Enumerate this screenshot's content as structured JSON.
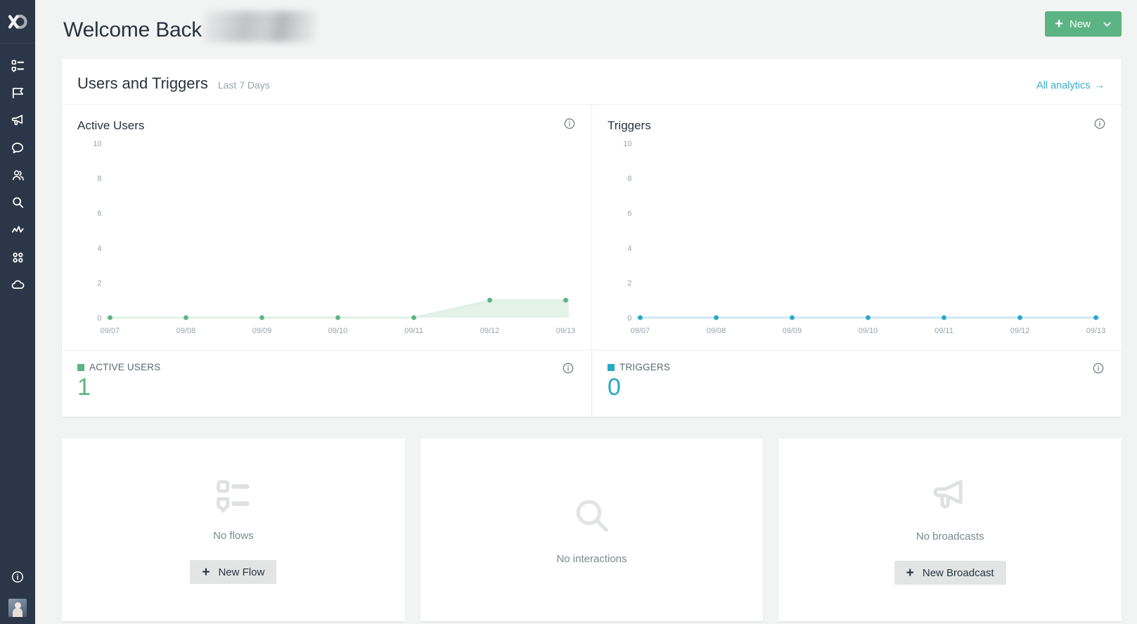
{
  "sidebar": {
    "logo_name": "textit-logo",
    "items": [
      {
        "name": "flows-icon",
        "label": "Flows"
      },
      {
        "name": "campaigns-icon",
        "label": "Campaigns"
      },
      {
        "name": "broadcasts-icon",
        "label": "Broadcasts"
      },
      {
        "name": "messages-icon",
        "label": "Messages"
      },
      {
        "name": "contacts-icon",
        "label": "Contacts"
      },
      {
        "name": "search-icon",
        "label": "Search"
      },
      {
        "name": "analytics-icon",
        "label": "Analytics"
      },
      {
        "name": "apps-icon",
        "label": "Apps"
      },
      {
        "name": "channels-icon",
        "label": "Channels"
      }
    ],
    "bottom": [
      {
        "name": "info-icon",
        "label": "Help"
      },
      {
        "name": "avatar",
        "label": "Account"
      }
    ]
  },
  "header": {
    "greeting": "Welcome Back",
    "user_name_redacted": "",
    "new_button": {
      "label": "New",
      "plus_glyph": "+",
      "chevron": "chevron-down-icon",
      "color": "#5cb383"
    }
  },
  "analytics": {
    "title": "Users and Triggers",
    "subtitle": "Last 7 Days",
    "all_analytics_label": "All analytics",
    "all_analytics_arrow": "→",
    "link_color": "#3aaecb",
    "charts": [
      {
        "title": "Active Users",
        "info": "info-icon"
      },
      {
        "title": "Triggers",
        "info": "info-icon"
      }
    ],
    "stats": [
      {
        "label": "ACTIVE USERS",
        "value": "1",
        "color": "#5cb383",
        "info": "info-icon"
      },
      {
        "label": "TRIGGERS",
        "value": "0",
        "color": "#26a9c7",
        "info": "info-icon"
      }
    ]
  },
  "chart_data": [
    {
      "type": "area",
      "title": "Active Users",
      "x": [
        "09/07",
        "09/08",
        "09/09",
        "09/10",
        "09/11",
        "09/12",
        "09/13"
      ],
      "values": [
        0,
        0,
        0,
        0,
        0,
        1,
        1
      ],
      "yticks": [
        0,
        2,
        4,
        6,
        8,
        10
      ],
      "ylim": [
        0,
        10
      ],
      "xlabel": "",
      "ylabel": "",
      "grid": false,
      "legend": "ACTIVE USERS",
      "color": "#5cb383",
      "fill": "#dff0e4"
    },
    {
      "type": "area",
      "title": "Triggers",
      "x": [
        "09/07",
        "09/08",
        "09/09",
        "09/10",
        "09/11",
        "09/12",
        "09/13"
      ],
      "values": [
        0,
        0,
        0,
        0,
        0,
        0,
        0
      ],
      "yticks": [
        0,
        2,
        4,
        6,
        8,
        10
      ],
      "ylim": [
        0,
        10
      ],
      "xlabel": "",
      "ylabel": "",
      "grid": false,
      "legend": "TRIGGERS",
      "color": "#26a9c7",
      "fill": "#cfe9f2"
    }
  ],
  "bottom_cards": [
    {
      "icon": "flows-icon",
      "text": "No flows",
      "button": "New Flow",
      "plus": "+"
    },
    {
      "icon": "search-icon",
      "text": "No interactions",
      "button": null,
      "plus": "+"
    },
    {
      "icon": "megaphone-icon",
      "text": "No broadcasts",
      "button": "New Broadcast",
      "plus": "+"
    }
  ]
}
